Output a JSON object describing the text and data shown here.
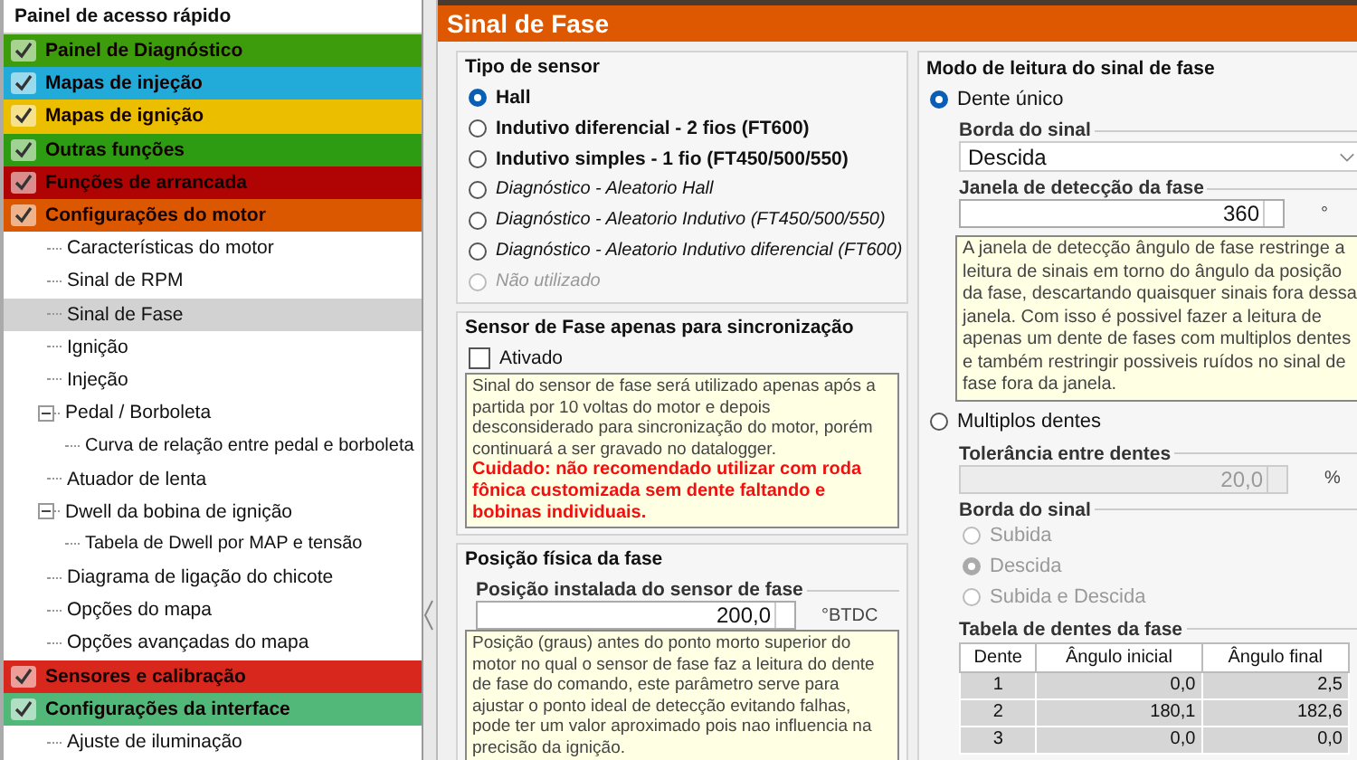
{
  "sidebar": {
    "title": "Painel de acesso rápido",
    "items": [
      {
        "label": "Painel de Diagnóstico",
        "color": "#3c9c0c"
      },
      {
        "label": "Mapas de injeção",
        "color": "#22aad8"
      },
      {
        "label": "Mapas de ignição",
        "color": "#ecbe00"
      },
      {
        "label": "Outras funções",
        "color": "#2d9c12"
      },
      {
        "label": "Funções de arrancada",
        "color": "#b00404"
      },
      {
        "label": "Configurações do motor",
        "color": "#dc5800",
        "children": [
          {
            "label": "Características do motor",
            "selected": false
          },
          {
            "label": "Sinal de RPM",
            "selected": false
          },
          {
            "label": "Sinal de Fase",
            "selected": true
          },
          {
            "label": "Ignição",
            "selected": false
          },
          {
            "label": "Injeção",
            "selected": false
          },
          {
            "label": "Pedal / Borboleta",
            "selected": false,
            "expanded": true,
            "children": [
              {
                "label": "Curva de relação entre pedal e borboleta",
                "selected": false
              }
            ]
          },
          {
            "label": "Atuador de lenta",
            "selected": false
          },
          {
            "label": "Dwell da bobina de ignição",
            "selected": false,
            "expanded": true,
            "children": [
              {
                "label": "Tabela de Dwell por MAP e tensão",
                "selected": false
              }
            ]
          },
          {
            "label": "Diagrama de ligação do chicote",
            "selected": false
          },
          {
            "label": "Opções do mapa",
            "selected": false
          },
          {
            "label": "Opções avançadas do mapa",
            "selected": false
          }
        ]
      },
      {
        "label": "Sensores e calibração",
        "color": "#d8281e"
      },
      {
        "label": "Configurações da interface",
        "color": "#52b87a",
        "children": [
          {
            "label": "Ajuste de iluminação",
            "selected": false
          }
        ]
      }
    ]
  },
  "page": {
    "title": "Sinal de Fase"
  },
  "sensor_type": {
    "title": "Tipo de sensor",
    "options": [
      {
        "label": "Hall",
        "kind": "bold",
        "selected": true,
        "disabled": false
      },
      {
        "label": "Indutivo diferencial - 2 fios (FT600)",
        "kind": "bold",
        "selected": false,
        "disabled": false
      },
      {
        "label": "Indutivo simples - 1 fio (FT450/500/550)",
        "kind": "bold",
        "selected": false,
        "disabled": false
      },
      {
        "label": "Diagnóstico - Aleatorio Hall",
        "kind": "italic",
        "selected": false,
        "disabled": false
      },
      {
        "label": "Diagnóstico - Aleatorio Indutivo (FT450/500/550)",
        "kind": "italic",
        "selected": false,
        "disabled": false
      },
      {
        "label": "Diagnóstico - Aleatorio Indutivo diferencial (FT600)",
        "kind": "italic",
        "selected": false,
        "disabled": false
      },
      {
        "label": "Não utilizado",
        "kind": "italic",
        "selected": false,
        "disabled": true
      }
    ]
  },
  "sync": {
    "title": "Sensor de Fase apenas para sincronização",
    "checkbox": {
      "label": "Ativado",
      "checked": false
    },
    "note": "Sinal do sensor de fase será utilizado apenas após a partida por 10 voltas do motor e depois desconsiderado para sincronização do motor, porém continuará a ser gravado no datalogger.",
    "warning": "Cuidado: não recomendado utilizar com roda fônica customizada sem dente faltando e bobinas individuais."
  },
  "position": {
    "title": "Posição física da fase",
    "field": {
      "label": "Posição instalada do sensor de fase",
      "value": "200,0",
      "unit": "°BTDC"
    },
    "note": "Posição (graus) antes do ponto morto superior do motor no qual o sensor de fase faz a leitura do dente de fase do comando, este parâmetro serve para ajustar o ponto ideal de detecção evitando falhas, pode ter um valor aproximado pois nao influencia na precisão da ignição."
  },
  "reading_mode": {
    "title": "Modo de leitura do sinal de fase",
    "single_tooth": {
      "label": "Dente único",
      "selected": true,
      "edge": {
        "label": "Borda do sinal",
        "value": "Descida"
      },
      "window": {
        "label": "Janela de detecção da fase",
        "value": "360",
        "unit": "°"
      },
      "note": "A janela de detecção ângulo de fase restringe a leitura de sinais em torno do ângulo da posição da fase, descartando quaisquer sinais fora dessa janela. Com isso é possivel fazer a leitura de apenas um dente de fases com multiplos dentes e também restringir possiveis ruídos no sinal de fase fora da janela."
    },
    "multi_tooth": {
      "label": "Multiplos dentes",
      "selected": false,
      "tolerance": {
        "label": "Tolerância entre dentes",
        "value": "20,0",
        "unit": "%"
      },
      "edge": {
        "label": "Borda do sinal",
        "options": [
          {
            "label": "Subida",
            "selected": false
          },
          {
            "label": "Descida",
            "selected": true
          },
          {
            "label": "Subida e Descida",
            "selected": false
          }
        ]
      },
      "table": {
        "title": "Tabela de dentes da fase",
        "columns": [
          "Dente",
          "Ângulo inicial",
          "Ângulo final"
        ],
        "rows": [
          [
            "1",
            "0,0",
            "2,5"
          ],
          [
            "2",
            "180,1",
            "182,6"
          ],
          [
            "3",
            "0,0",
            "0,0"
          ]
        ]
      }
    }
  }
}
